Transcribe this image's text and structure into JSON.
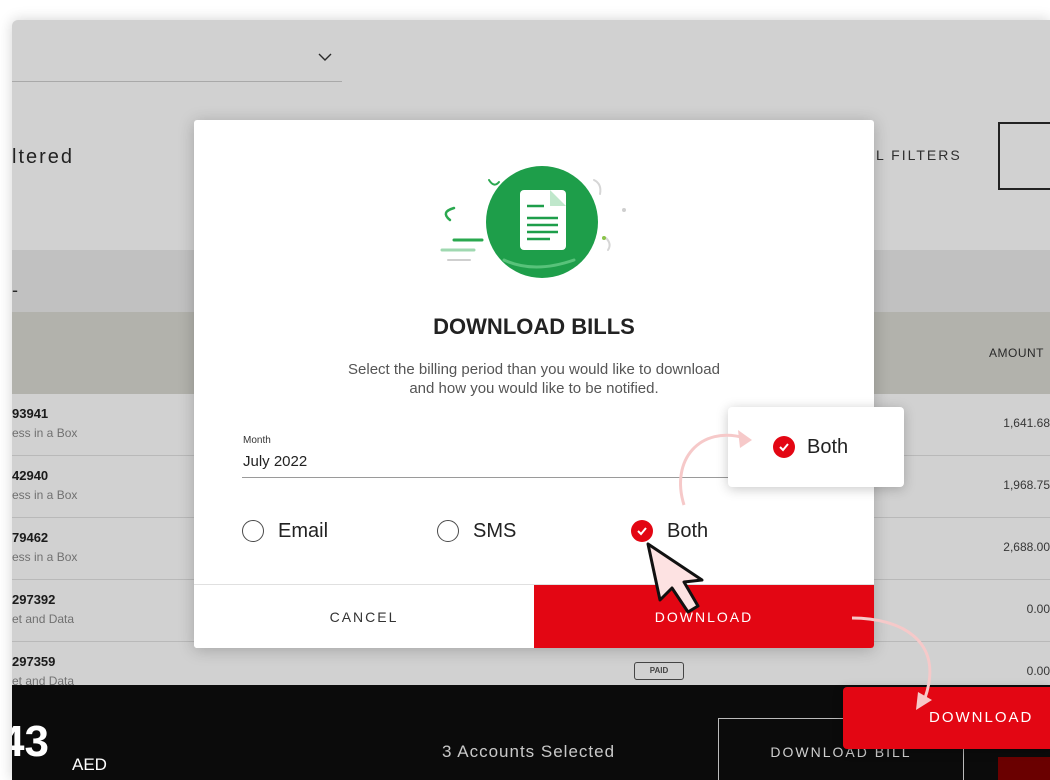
{
  "background": {
    "filtered_label": "ltered",
    "all_filters_label": "L FILTERS",
    "band_dash": "-",
    "amount_header": "AMOUNT",
    "rows": [
      {
        "number": "93941",
        "plan": "ess in a Box",
        "amount": "1,641.68"
      },
      {
        "number": "42940",
        "plan": "ess in a Box",
        "amount": "1,968.75"
      },
      {
        "number": "79462",
        "plan": "ess in a Box",
        "amount": "2,688.00"
      },
      {
        "number": "297392",
        "plan": "et and Data",
        "amount": "0.00"
      },
      {
        "number": "297359",
        "plan": "et and Data",
        "amount": "0.00"
      }
    ],
    "paid_badge": "PAID"
  },
  "footer": {
    "total_value": "43",
    "currency": "AED",
    "accounts_selected": "3 Accounts Selected",
    "download_bill_label": "DOWNLOAD BILL"
  },
  "modal": {
    "title": "DOWNLOAD BILLS",
    "description": "Select the billing period than you would like to download and how you would like to be notified.",
    "month_label": "Month",
    "month_value": "July 2022",
    "options": {
      "email": "Email",
      "sms": "SMS",
      "both": "Both"
    },
    "selected_option": "Both",
    "cancel_label": "CANCEL",
    "download_label": "DOWNLOAD"
  },
  "callouts": {
    "both_label": "Both",
    "download_label": "DOWNLOAD"
  },
  "colors": {
    "accent_red": "#e30613",
    "illustration_green": "#1e9e4a",
    "footer_black": "#0b0b0b"
  },
  "icons": {
    "dropdown": "chevron-down-icon",
    "illustration": "document-icon",
    "check": "check-icon",
    "cursor": "pointer-cursor-icon"
  }
}
